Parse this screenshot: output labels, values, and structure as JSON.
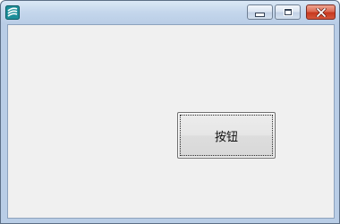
{
  "window": {
    "title": "",
    "icon": "app-icon"
  },
  "controls": {
    "minimize_icon": "minimize-icon",
    "maximize_icon": "maximize-icon",
    "close_icon": "close-icon"
  },
  "main": {
    "button_label": "按钮"
  },
  "colors": {
    "titlebar": "#b9cde6",
    "client_bg": "#f0f0f0",
    "close_button": "#c7391f"
  }
}
